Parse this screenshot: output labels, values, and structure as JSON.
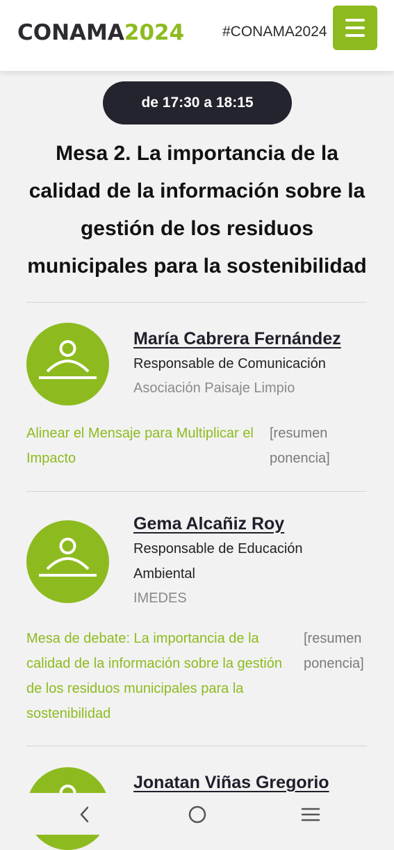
{
  "header": {
    "logo_main": "CONAMA",
    "logo_year": "2024",
    "hashtag": "#CONAMA2024",
    "menu_icon": "hamburger-icon",
    "accent_color": "#8dbb1f"
  },
  "session": {
    "time": "de 17:30 a 18:15",
    "title": "Mesa 2. La importancia de la calidad de la información sobre la gestión de los residuos municipales para la sostenibilidad"
  },
  "speakers": [
    {
      "name": "María Cabrera Fernández",
      "role": "Responsable de Comunicación",
      "org": "Asociación Paisaje Limpio",
      "talk": "Alinear el Mensaje para Multiplicar el Impacto",
      "summary": "[resumen ponencia]",
      "avatar_icon": "person-placeholder-icon"
    },
    {
      "name": "Gema Alcañiz Roy",
      "role": "Responsable de Educación Ambiental",
      "org": "IMEDES",
      "talk": "Mesa de debate: La importancia de la calidad de la información sobre la gestión de los residuos municipales para la sostenibilidad",
      "summary": "[resumen ponencia]",
      "avatar_icon": "person-placeholder-icon"
    },
    {
      "name": "Jonatan Viñas Gregorio",
      "avatar_icon": "person-placeholder-icon"
    }
  ],
  "navbar": {
    "back_icon": "back-chevron-icon",
    "home_icon": "home-circle-icon",
    "recents_icon": "recent-apps-icon"
  }
}
